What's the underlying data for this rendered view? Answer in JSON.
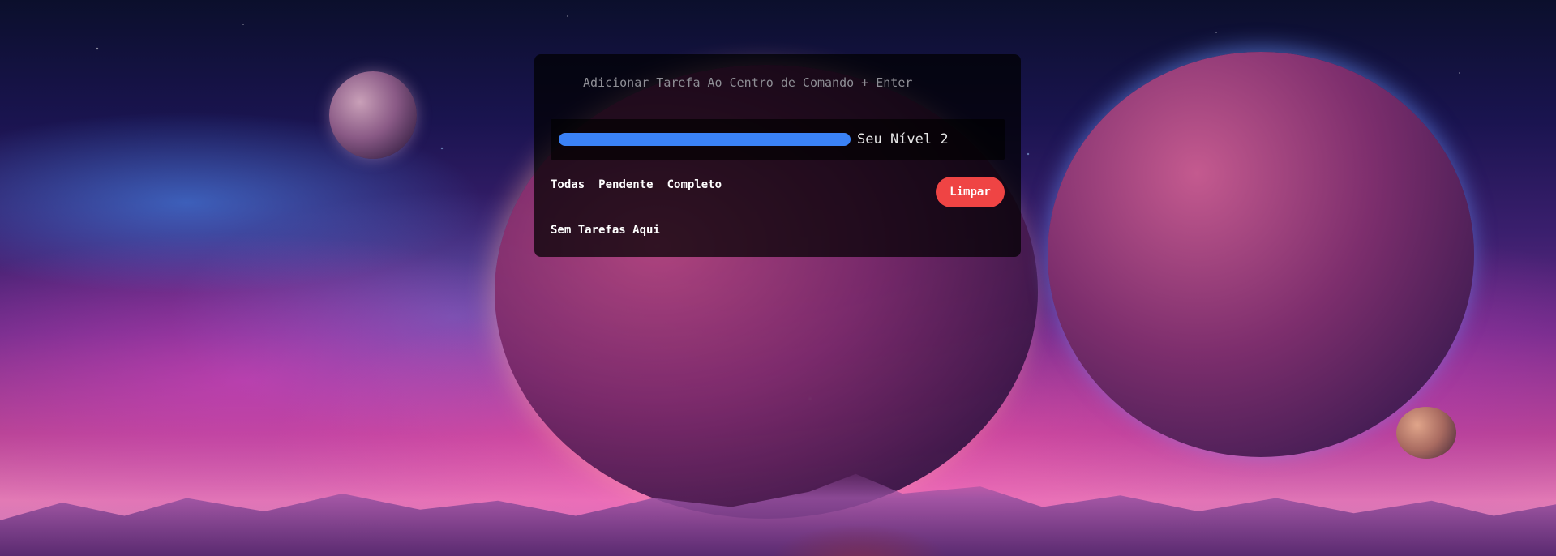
{
  "task_input": {
    "placeholder": "Adicionar Tarefa Ao Centro de Comando + Enter",
    "value": ""
  },
  "level": {
    "label": "Seu Nível 2",
    "progress_fraction": 1.0,
    "bar_color": "#3b82f6"
  },
  "filters": {
    "all_label": "Todas",
    "pending_label": "Pendente",
    "completed_label": "Completo"
  },
  "clear_button": {
    "label": "Limpar",
    "color": "#ef4444"
  },
  "empty_state": {
    "message": "Sem Tarefas Aqui"
  }
}
